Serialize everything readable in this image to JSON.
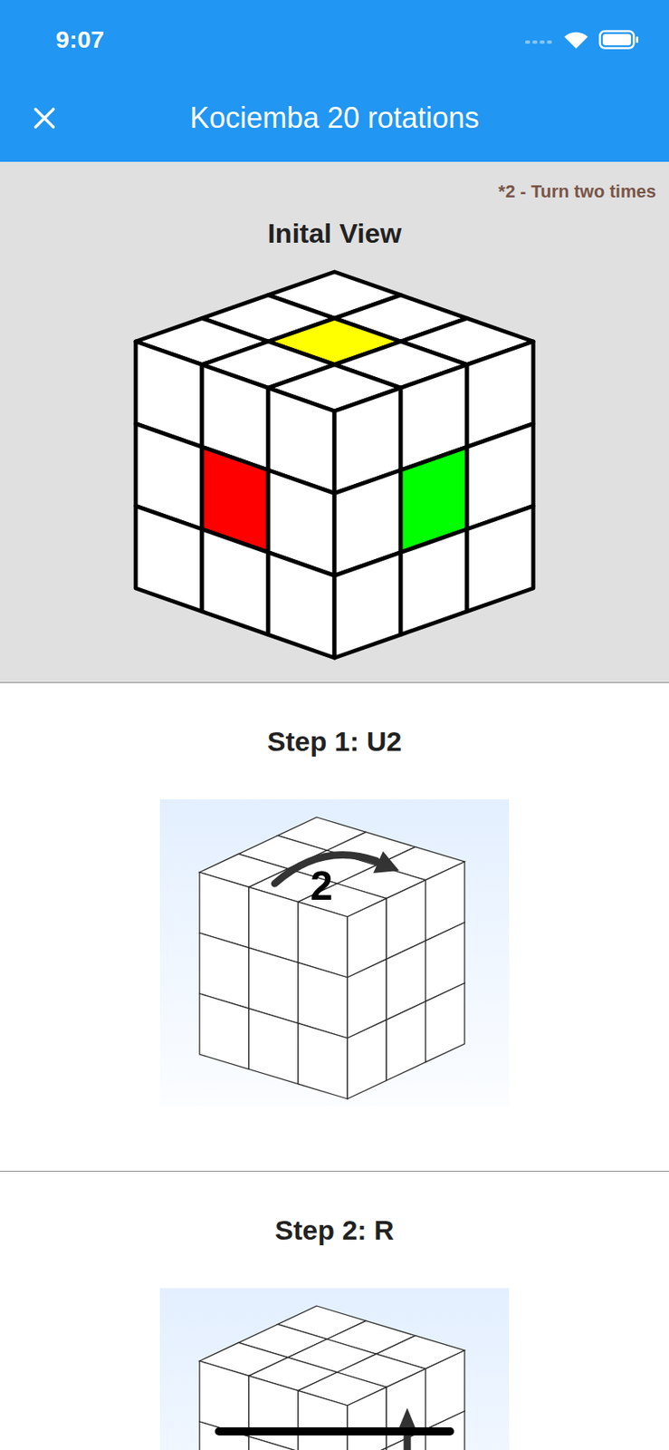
{
  "status_bar": {
    "time": "9:07"
  },
  "app_bar": {
    "title": "Kociemba 20 rotations"
  },
  "note": "*2 - Turn two times",
  "initial_view": {
    "title": "Inital View",
    "faces": [
      {
        "face": "top",
        "color": "#ffff00"
      },
      {
        "face": "left",
        "color": "#ff0000"
      },
      {
        "face": "right",
        "color": "#00ff00"
      }
    ]
  },
  "steps": [
    {
      "title": "Step 1: U2",
      "kind": "top",
      "label": "2"
    },
    {
      "title": "Step 2: R",
      "kind": "right",
      "label": ""
    }
  ]
}
